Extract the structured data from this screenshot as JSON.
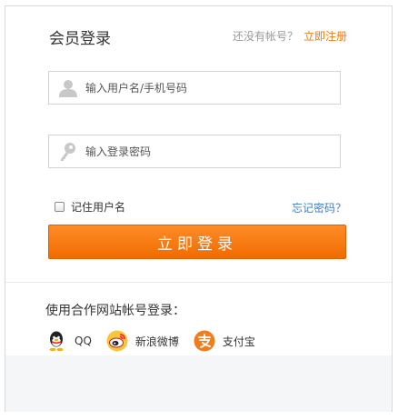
{
  "header": {
    "title": "会员登录",
    "no_account_text": "还没有帐号？",
    "register_link": "立即注册"
  },
  "form": {
    "username_placeholder": "输入用户名/手机号码",
    "password_placeholder": "输入登录密码",
    "remember_label": "记住用户名",
    "remember_checked": false,
    "forgot_link": "忘记密码？",
    "login_button": "立即登录"
  },
  "third_party": {
    "title": "使用合作网站帐号登录：",
    "providers": [
      {
        "label": "QQ",
        "icon": "qq-icon"
      },
      {
        "label": "新浪微博",
        "icon": "weibo-icon"
      },
      {
        "label": "支付宝",
        "icon": "alipay-icon"
      }
    ]
  },
  "colors": {
    "accent": "#f07a12",
    "link_blue": "#3f7fc1",
    "button_top": "#ff8c28",
    "button_bottom": "#f06b00"
  }
}
